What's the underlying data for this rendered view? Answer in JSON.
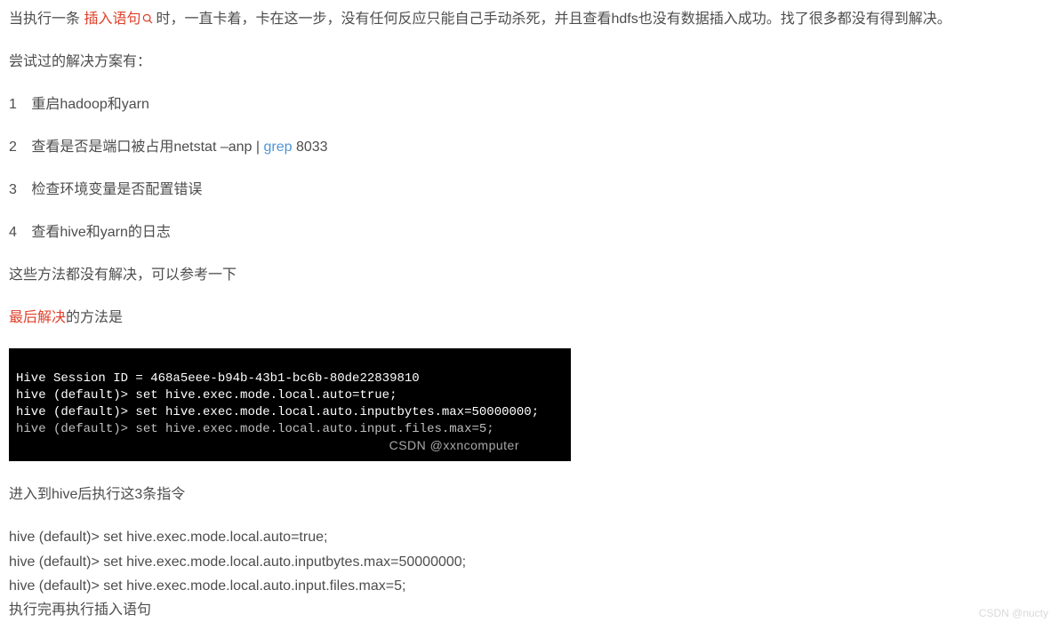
{
  "intro": {
    "prefix": "当执行一条",
    "highlight": "插入语句",
    "after_icon": "时，一直卡着，卡在这一步，没有任何反应只能自己手动杀死，并且查看hdfs也没有数据插入成功。找了很多都没有得到解决。"
  },
  "tried_heading": "尝试过的解决方案有：",
  "steps": [
    {
      "num": "1",
      "text": "重启hadoop和yarn"
    },
    {
      "num": "2",
      "text_before": "查看是否是端口被占用netstat –anp | ",
      "link": "grep",
      "text_after": " 8033"
    },
    {
      "num": "3",
      "text": "检查环境变量是否配置错误"
    },
    {
      "num": "4",
      "text": "查看hive和yarn的日志"
    }
  ],
  "not_solved": "这些方法都没有解决，可以参考一下",
  "final": {
    "highlight": "最后解决",
    "suffix": "的方法是"
  },
  "terminal": {
    "line1": "Hive Session ID = 468a5eee-b94b-43b1-bc6b-80de22839810",
    "line2": "hive (default)> set hive.exec.mode.local.auto=true;",
    "line3": "hive (default)> set hive.exec.mode.local.auto.inputbytes.max=50000000;",
    "line4": "hive (default)> set hive.exec.mode.local.auto.input.files.max=5;",
    "watermark": "CSDN @xxncomputer"
  },
  "after_terminal": "进入到hive后执行这3条指令",
  "commands": {
    "c1": "hive (default)> set hive.exec.mode.local.auto=true;",
    "c2": "hive (default)> set hive.exec.mode.local.auto.inputbytes.max=50000000;",
    "c3": "hive (default)> set hive.exec.mode.local.auto.input.files.max=5;"
  },
  "final_line": "执行完再执行插入语句",
  "page_watermark": "CSDN @nucty"
}
